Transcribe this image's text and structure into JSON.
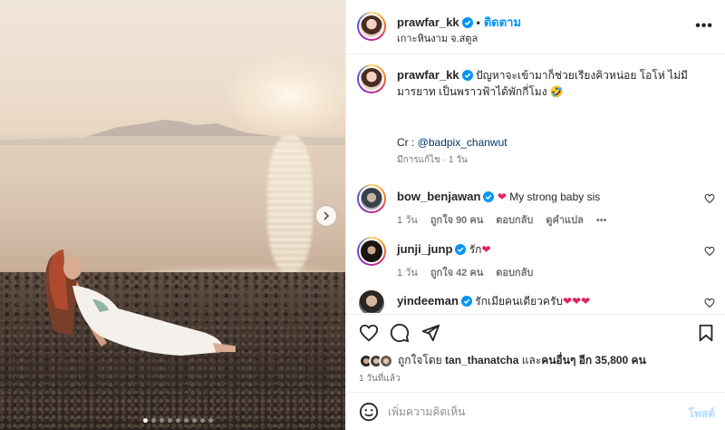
{
  "post": {
    "author": "prawfar_kk",
    "follow_label": "ติดตาม",
    "separator": "•",
    "location": "เกาะหินงาม จ.สตูล",
    "more_label": "•••"
  },
  "caption": {
    "author": "prawfar_kk",
    "text": "ปัญหาจะเข้ามาก็ช่วยเรียงคิวหน่อย โอโห่ ไม่มีมารยาท เป็นพราวฟ้าได้พักกี่โมง 🤣",
    "credit_prefix": "Cr : ",
    "credit_mention": "@badpix_chanwut",
    "edited": "มีการแก้ไข · 1 วัน"
  },
  "comments": [
    {
      "user": "bow_benjawan",
      "text": "My strong baby sis",
      "prefix_heart": "❤",
      "time": "1 วัน",
      "likes": "ถูกใจ 90 คน",
      "reply": "ตอบกลับ",
      "translate": "ดูคำแปล",
      "more": "•••"
    },
    {
      "user": "junji_junp",
      "text": "รัก",
      "suffix_heart": "❤",
      "time": "1 วัน",
      "likes": "ถูกใจ 42 คน",
      "reply": "ตอบกลับ"
    },
    {
      "user": "yindeeman",
      "text": "รักเมียคนเดียวครับ",
      "suffix_heart": "❤❤❤"
    }
  ],
  "likes": {
    "prefix": "ถูกใจโดย",
    "user": "tan_thanatcha",
    "and": "และ",
    "others": "คนอื่นๆ อีก 35,800 คน"
  },
  "posted_time": "1 วันที่แล้ว",
  "add_comment": {
    "placeholder": "เพิ่มความคิดเห็น",
    "post_label": "โพสต์"
  },
  "icons": {
    "verified": "verified-badge-icon",
    "like": "heart-icon",
    "comment": "comment-icon",
    "share": "paper-plane-icon",
    "save": "bookmark-icon",
    "emoji": "smiley-icon",
    "next": "chevron-right-icon"
  },
  "carousel": {
    "count": 9,
    "active": 1
  },
  "colors": {
    "accent": "#0095f6",
    "verified": "#0095f6",
    "heart": "#e0245e",
    "muted": "#737373"
  }
}
